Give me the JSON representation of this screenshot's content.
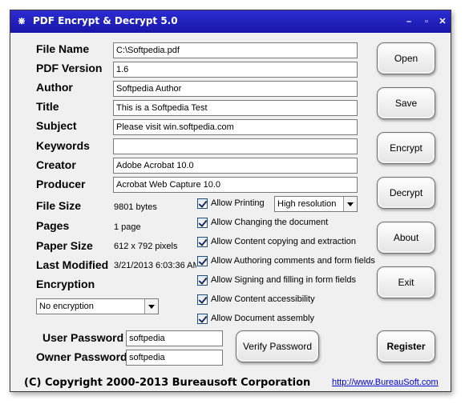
{
  "window": {
    "title": "PDF Encrypt & Decrypt 5.0"
  },
  "fields": [
    {
      "label": "File Name",
      "value": "C:\\Softpedia.pdf"
    },
    {
      "label": "PDF Version",
      "value": "1.6"
    },
    {
      "label": "Author",
      "value": "Softpedia Author"
    },
    {
      "label": "Title",
      "value": "This is a Softpedia Test"
    },
    {
      "label": "Subject",
      "value": "Please visit win.softpedia.com"
    },
    {
      "label": "Keywords",
      "value": ""
    },
    {
      "label": "Creator",
      "value": "Adobe Acrobat 10.0"
    },
    {
      "label": "Producer",
      "value": "Acrobat Web Capture 10.0"
    }
  ],
  "info": [
    {
      "label": "File Size",
      "value": "9801 bytes"
    },
    {
      "label": "Pages",
      "value": "1 page"
    },
    {
      "label": "Paper Size",
      "value": "612 x 792 pixels"
    },
    {
      "label": "Last Modified",
      "value": "3/21/2013 6:03:36 AM"
    }
  ],
  "encryption": {
    "label": "Encryption",
    "selected": "No encryption"
  },
  "permissions": [
    {
      "label": "Allow Printing",
      "checked": true
    },
    {
      "label": "Allow Changing the document",
      "checked": true
    },
    {
      "label": "Allow Content copying and extraction",
      "checked": true
    },
    {
      "label": "Allow Authoring comments and form fields",
      "checked": true
    },
    {
      "label": "Allow Signing and filling in form fields",
      "checked": true
    },
    {
      "label": "Allow Content accessibility",
      "checked": true
    },
    {
      "label": "Allow Document assembly",
      "checked": true
    }
  ],
  "printing_resolution": "High resolution",
  "passwords": {
    "user_label": "User Password",
    "user_value": "softpedia",
    "owner_label": "Owner Password",
    "owner_value": "softpedia"
  },
  "buttons": {
    "open": "Open",
    "save": "Save",
    "encrypt": "Encrypt",
    "decrypt": "Decrypt",
    "about": "About",
    "exit": "Exit",
    "verify": "Verify Password",
    "register": "Register"
  },
  "footer": {
    "copyright": "(C) Copyright 2000-2013 Bureausoft Corporation",
    "link": "http://www.BureauSoft.com"
  }
}
